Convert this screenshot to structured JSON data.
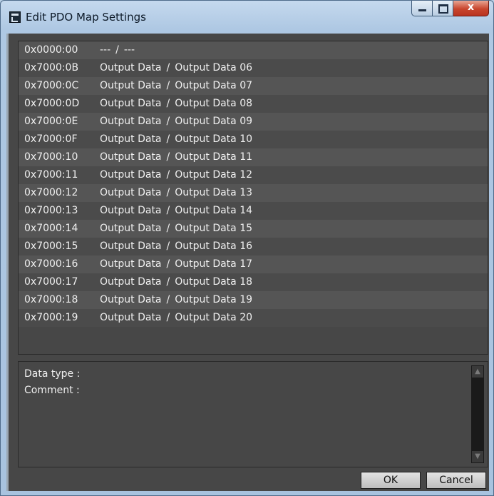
{
  "window": {
    "title": "Edit PDO Map Settings",
    "close_glyph": "x"
  },
  "entries": [
    {
      "index": "0x0000:00",
      "group": "---",
      "name": "---"
    },
    {
      "index": "0x7000:0B",
      "group": "Output Data",
      "name": "Output Data 06"
    },
    {
      "index": "0x7000:0C",
      "group": "Output Data",
      "name": "Output Data 07"
    },
    {
      "index": "0x7000:0D",
      "group": "Output Data",
      "name": "Output Data 08"
    },
    {
      "index": "0x7000:0E",
      "group": "Output Data",
      "name": "Output Data 09"
    },
    {
      "index": "0x7000:0F",
      "group": "Output Data",
      "name": "Output Data 10"
    },
    {
      "index": "0x7000:10",
      "group": "Output Data",
      "name": "Output Data 11"
    },
    {
      "index": "0x7000:11",
      "group": "Output Data",
      "name": "Output Data 12"
    },
    {
      "index": "0x7000:12",
      "group": "Output Data",
      "name": "Output Data 13"
    },
    {
      "index": "0x7000:13",
      "group": "Output Data",
      "name": "Output Data 14"
    },
    {
      "index": "0x7000:14",
      "group": "Output Data",
      "name": "Output Data 15"
    },
    {
      "index": "0x7000:15",
      "group": "Output Data",
      "name": "Output Data 16"
    },
    {
      "index": "0x7000:16",
      "group": "Output Data",
      "name": "Output Data 17"
    },
    {
      "index": "0x7000:17",
      "group": "Output Data",
      "name": "Output Data 18"
    },
    {
      "index": "0x7000:18",
      "group": "Output Data",
      "name": "Output Data 19"
    },
    {
      "index": "0x7000:19",
      "group": "Output Data",
      "name": "Output Data 20"
    }
  ],
  "separator": "/",
  "details": {
    "data_type_label": "Data type :",
    "comment_label": "Comment :"
  },
  "buttons": {
    "ok": "OK",
    "cancel": "Cancel"
  },
  "icons": {
    "app": "window-app-icon",
    "minimize": "minimize-icon",
    "maximize": "maximize-icon",
    "close": "close-icon",
    "scroll_up": "scroll-up-arrow-icon",
    "scroll_down": "scroll-down-arrow-icon"
  }
}
